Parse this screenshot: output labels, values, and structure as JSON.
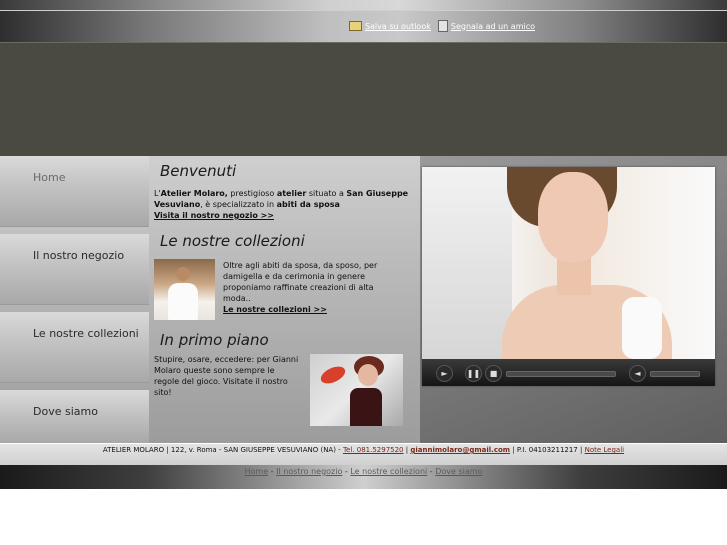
{
  "top_links": {
    "outlook": "Salva su outlook",
    "friend": "Segnala ad un amico"
  },
  "nav": {
    "items": [
      "Home",
      "Il nostro negozio",
      "Le nostre collezioni",
      "Dove siamo"
    ],
    "active": "Home"
  },
  "content": {
    "welcome_title": "Benvenuti",
    "welcome_text": {
      "p1": "L'",
      "brand": "Atelier Molaro,",
      "p2": " prestigioso ",
      "b2": "atelier",
      "p3": " situato a ",
      "city": "San Giuseppe Vesuviano",
      "p4": ", è specializzato in ",
      "b4": "abiti da sposa"
    },
    "welcome_link": "Visita il nostro negozio >>",
    "collections_title": "Le nostre collezioni",
    "collections_text": "Oltre agli abiti da sposa, da sposo, per damigella e da cerimonia in genere proponiamo raffinate creazioni di alta moda..",
    "collections_link": "Le nostre collezioni >>",
    "spotlight_title": "In primo piano",
    "spotlight_text": "Stupire, osare, eccedere: per Gianni Molaro queste sono sempre le regole del gioco. Visitate il nostro sito!"
  },
  "footer": {
    "address": "ATELIER MOLARO | 122, v. Roma - SAN GIUSEPPE VESUVIANO (NA) -",
    "phone": "Tel. 081.5297520",
    "sep1": "|",
    "email": "giannimolaro@gmail.com",
    "sep2": "| P.I. 04103211217 |",
    "legal": "Note Legali"
  },
  "footer_nav": [
    "Home",
    "Il nostro negozio",
    "Le nostre collezioni",
    "Dove siamo"
  ]
}
